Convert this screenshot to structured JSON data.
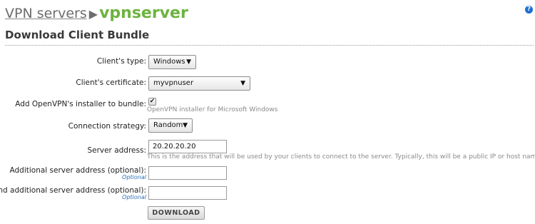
{
  "breadcrumb": {
    "parent": "VPN servers",
    "separator": "▶",
    "current": "vpnserver"
  },
  "help_icon": {
    "glyph": "?"
  },
  "page_title": "Download Client Bundle",
  "form": {
    "client_type": {
      "label": "Client's type:",
      "value": "Windows"
    },
    "client_certificate": {
      "label": "Client's certificate:",
      "value": "myvpnuser"
    },
    "add_installer": {
      "label": "Add OpenVPN's installer to bundle:",
      "checked": true,
      "help": "OpenVPN installer for Microsoft Windows"
    },
    "connection_strategy": {
      "label": "Connection strategy:",
      "value": "Random"
    },
    "server_address": {
      "label": "Server address:",
      "value": "20.20.20.20",
      "help": "This is the address that will be used by your clients to connect to the server. Typically, this will be a public IP or host name"
    },
    "additional_server_address": {
      "label": "Additional server address (optional):",
      "hint": "Optional",
      "value": ""
    },
    "second_additional_server_address": {
      "label": "Second additional server address (optional):",
      "hint": "Optional",
      "value": ""
    },
    "submit_label": "DOWNLOAD"
  },
  "icons": {
    "dropdown_arrow": "▼",
    "checkmark": "✔"
  }
}
